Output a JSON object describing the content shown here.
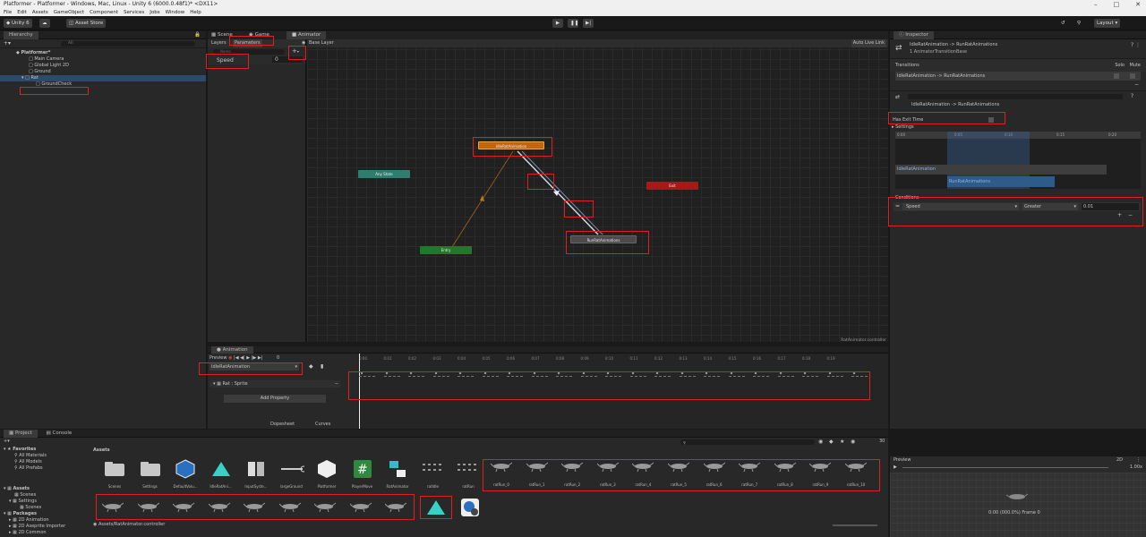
{
  "titlebar": {
    "title": "Platformer - Platformer - Windows, Mac, Linux - Unity 6 (6000.0.48f1)* <DX11>"
  },
  "menu": [
    "File",
    "Edit",
    "Assets",
    "GameObject",
    "Component",
    "Services",
    "Jobs",
    "Window",
    "Help"
  ],
  "toolbar": {
    "account": "Unity 6",
    "asset_store": "Asset Store",
    "layout": "Layout"
  },
  "hierarchy": {
    "tab": "Hierarchy",
    "search_placeholder": "All",
    "scene": "Platformer*",
    "items": [
      "Main Camera",
      "Global Light 2D",
      "Ground",
      "Rat",
      "GroundCheck"
    ]
  },
  "center_tabs": [
    "Scene",
    "Game",
    "Animator"
  ],
  "animator": {
    "layers_tab": "Layers",
    "params_tab": "Parameters",
    "base_layer": "Base Layer",
    "auto_live": "Auto Live Link",
    "search_placeholder": "Name",
    "param_name": "Speed",
    "param_value": "0",
    "nodes": {
      "any": "Any State",
      "idle": "IdleRatAnimation",
      "exit": "Exit",
      "entry": "Entry",
      "run": "RunRatAnimations"
    },
    "footer": "RatAnimator.controller"
  },
  "animation": {
    "tab": "Animation",
    "preview": "Preview",
    "frame": "0",
    "clip": "IdleRatAnimation",
    "property": "Rat : Sprite",
    "add_property": "Add Property",
    "dopesheet": "Dopesheet",
    "curves": "Curves",
    "ticks": [
      "0:00",
      "0:01",
      "0:02",
      "0:03",
      "0:04",
      "0:05",
      "0:06",
      "0:07",
      "0:08",
      "0:09",
      "0:10",
      "0:11",
      "0:12",
      "0:13",
      "0:14",
      "0:15",
      "0:16",
      "0:17",
      "0:18",
      "0:19"
    ]
  },
  "inspector": {
    "tab": "Inspector",
    "title": "IdleRatAnimation -> RunRatAnimations",
    "subtitle": "1 AnimatorTransitionBase",
    "transitions_label": "Transitions",
    "solo": "Solo",
    "mute": "Mute",
    "transition_item": "IdleRatAnimation -> RunRatAnimations",
    "transition_sub": "IdleRatAnimation -> RunRatAnimations",
    "has_exit_time": "Has Exit Time",
    "settings": "Settings",
    "timeline_ticks": [
      "0:00",
      "0:05",
      "0:10",
      "0:15",
      "0:20"
    ],
    "bar_idle": "IdleRatAnimation",
    "bar_run": "RunRatAnimations",
    "conditions": "Conditions",
    "cond_param": "Speed",
    "cond_op": "Greater",
    "cond_value": "0.01",
    "preview": "Preview",
    "preview_speed": "1.00x",
    "preview_status": "0:00 (000.0%) Frame 0"
  },
  "project": {
    "tab": "Project",
    "console": "Console",
    "favorites": "Favorites",
    "fav_items": [
      "All Materials",
      "All Models",
      "All Prefabs"
    ],
    "assets_root": "Assets",
    "tree": [
      "Scenes",
      "Settings",
      "Scenes"
    ],
    "packages": "Packages",
    "pkg_items": [
      "2D Animation",
      "2D Aseprite Importer",
      "2D Common"
    ],
    "breadcrumb": "Assets",
    "count": "30",
    "assets": [
      "Scenes",
      "Settings",
      "DefaultVolu...",
      "IdleRatAni...",
      "InputSyste...",
      "largeGround",
      "Platformer",
      "PlayerMove",
      "RatAnimator",
      "ratIdle",
      "ratRun"
    ],
    "sprites": [
      "ratRun_0",
      "ratRun_1",
      "ratRun_2",
      "ratRun_3",
      "ratRun_4",
      "ratRun_5",
      "ratRun_6",
      "ratRun_7",
      "ratRun_8",
      "ratRun_9",
      "ratRun_10"
    ],
    "status": "Assets/RatAnimator.controller"
  },
  "colors": {
    "accent": "#e02020",
    "idle_node": "#c2660b",
    "any_node": "#2e7d6e",
    "entry_node": "#1e7a2a",
    "exit_node": "#a81818",
    "run_node": "#4a4a4a",
    "bar_blue": "#2d5b8a"
  }
}
